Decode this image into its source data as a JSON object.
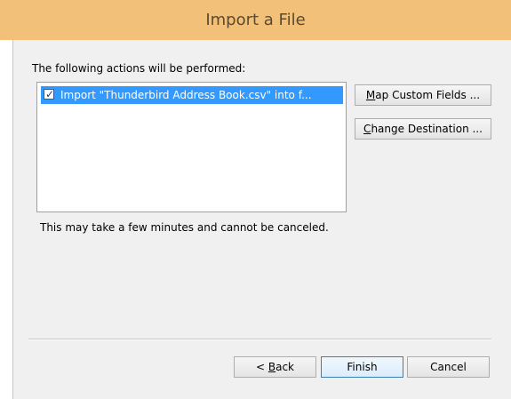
{
  "window": {
    "title": "Import a File"
  },
  "intro_text": "The following actions will be performed:",
  "actions_list": [
    {
      "label": "Import \"Thunderbird Address Book.csv\" into f...",
      "checked": true,
      "selected": true
    }
  ],
  "side_buttons": {
    "map_custom_fields": {
      "mnemonic": "M",
      "rest": "ap Custom Fields ..."
    },
    "change_destination": {
      "mnemonic": "C",
      "rest": "hange Destination ..."
    }
  },
  "note_text": "This may take a few minutes and cannot be canceled.",
  "footer_buttons": {
    "back": {
      "prefix": "< ",
      "mnemonic": "B",
      "rest": "ack"
    },
    "finish": "Finish",
    "cancel": "Cancel"
  },
  "colors": {
    "title_bar": "#f3c079",
    "selection": "#3399ff",
    "dialog_bg": "#f0f0f0"
  }
}
